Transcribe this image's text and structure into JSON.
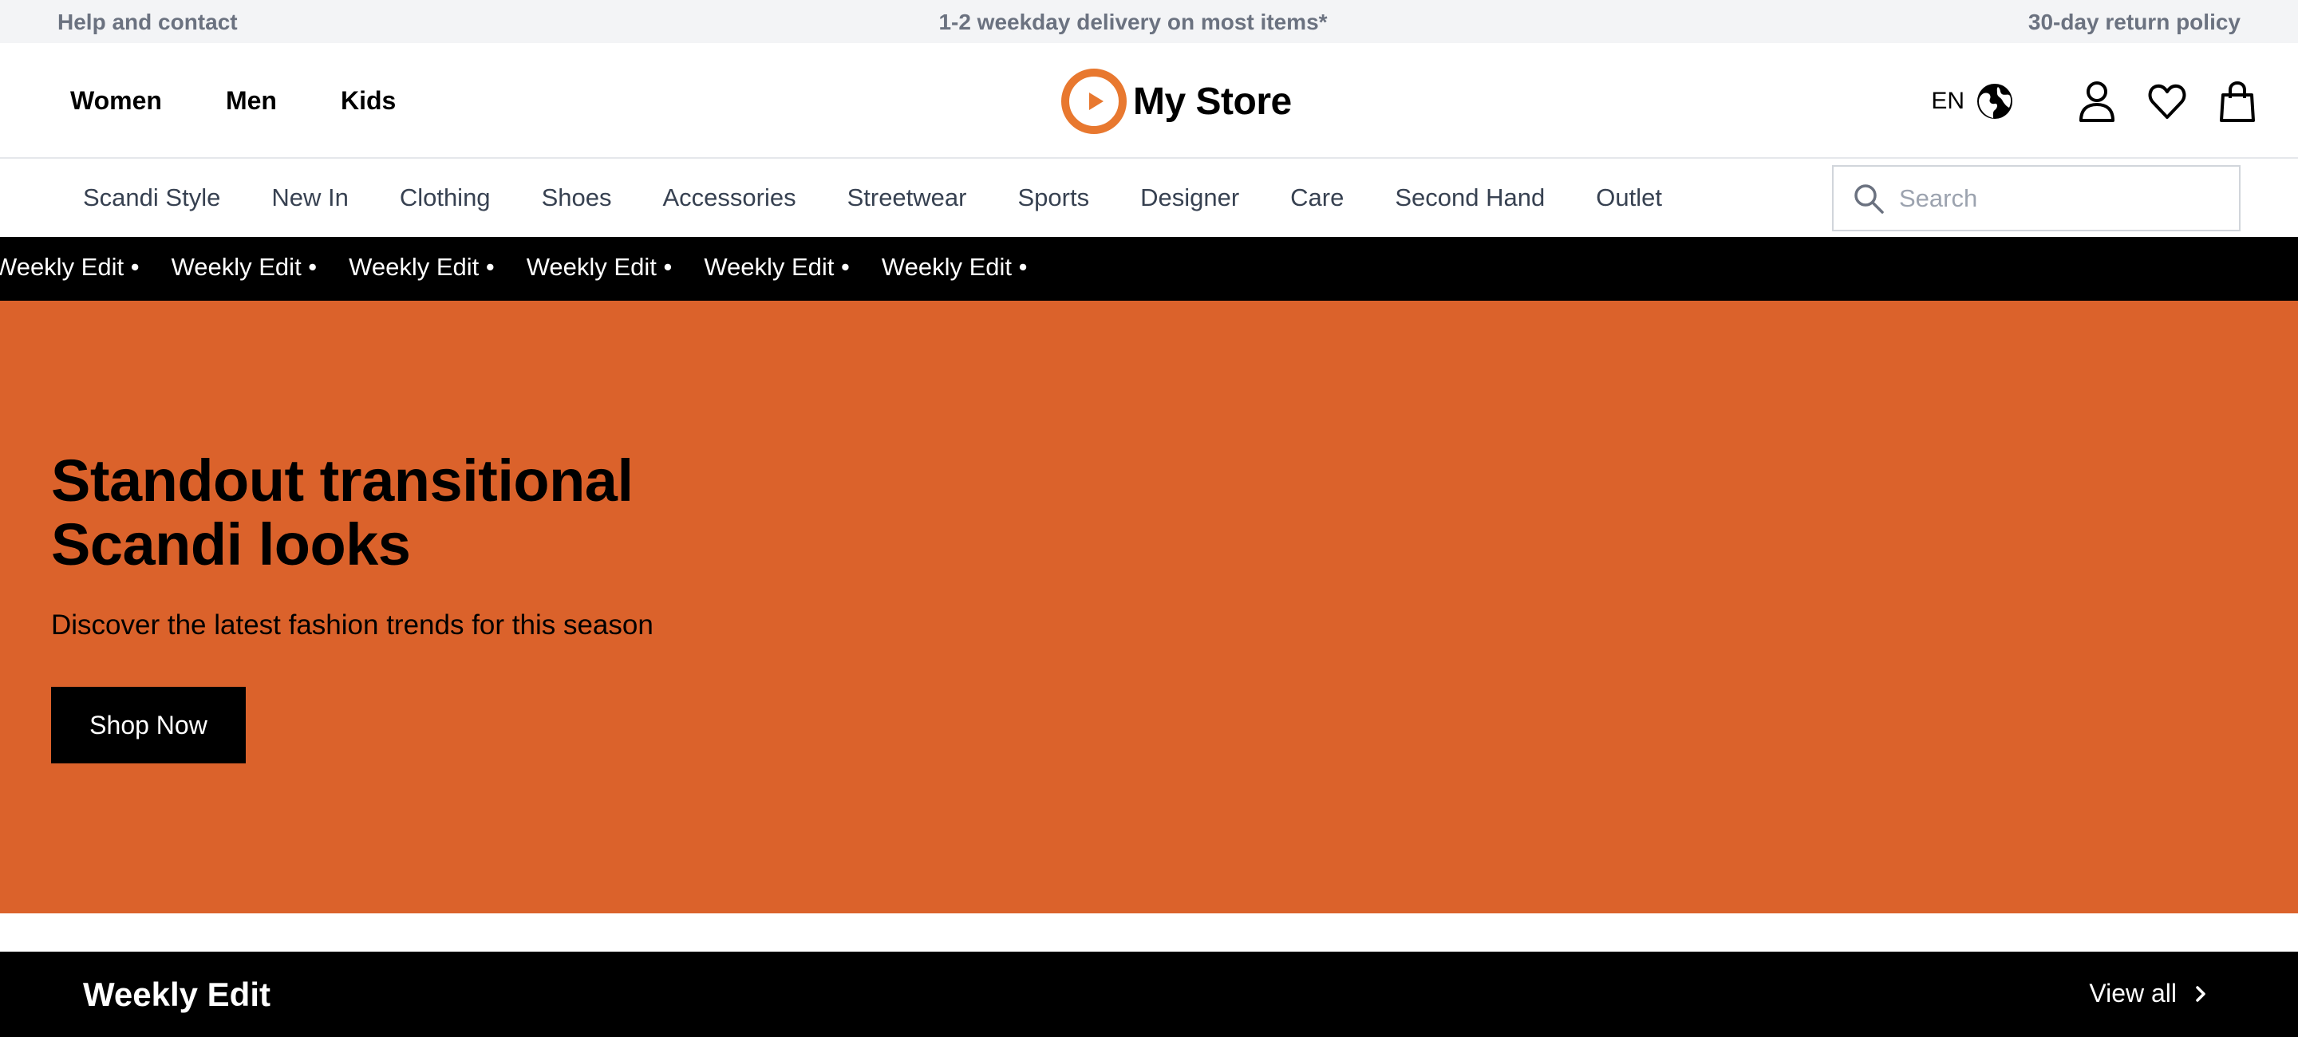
{
  "utility_bar": {
    "help": "Help and contact",
    "delivery": "1-2 weekday delivery on most items*",
    "returns": "30-day return policy"
  },
  "header": {
    "gender_nav": [
      "Women",
      "Men",
      "Kids"
    ],
    "brand_name": "My Store",
    "brand_color": "#e8782f",
    "language": "EN",
    "icons": [
      "globe-icon",
      "user-icon",
      "heart-icon",
      "shopping-bag-icon"
    ]
  },
  "category_nav": [
    "Scandi Style",
    "New In",
    "Clothing",
    "Shoes",
    "Accessories",
    "Streetwear",
    "Sports",
    "Designer",
    "Care",
    "Second Hand",
    "Outlet"
  ],
  "search": {
    "placeholder": "Search"
  },
  "marquee": {
    "items": [
      "Weekly Edit •",
      "Weekly Edit •",
      "Weekly Edit •",
      "Weekly Edit •",
      "Weekly Edit •",
      "Weekly Edit •"
    ]
  },
  "hero": {
    "title_line1": "Standout transitional",
    "title_line2": "Scandi looks",
    "subtitle": "Discover the latest fashion trends for this season",
    "cta": "Shop Now",
    "background": "#db622b"
  },
  "weekly_section": {
    "title": "Weekly Edit",
    "view_all": "View all"
  }
}
